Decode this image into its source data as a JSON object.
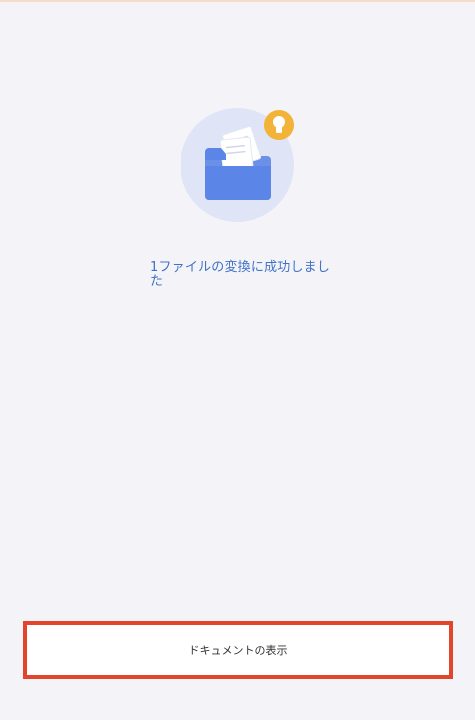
{
  "status": {
    "message": "1ファイルの変換に成功しました",
    "icon": "folder-with-documents-icon",
    "badge_icon": "lightbulb-icon"
  },
  "actions": {
    "view_documents_label": "ドキュメントの表示"
  },
  "colors": {
    "background": "#f4f3f8",
    "message_text": "#3f72c6",
    "highlight_border": "#e2452b",
    "folder": "#5b86e8",
    "badge": "#f2b338"
  }
}
